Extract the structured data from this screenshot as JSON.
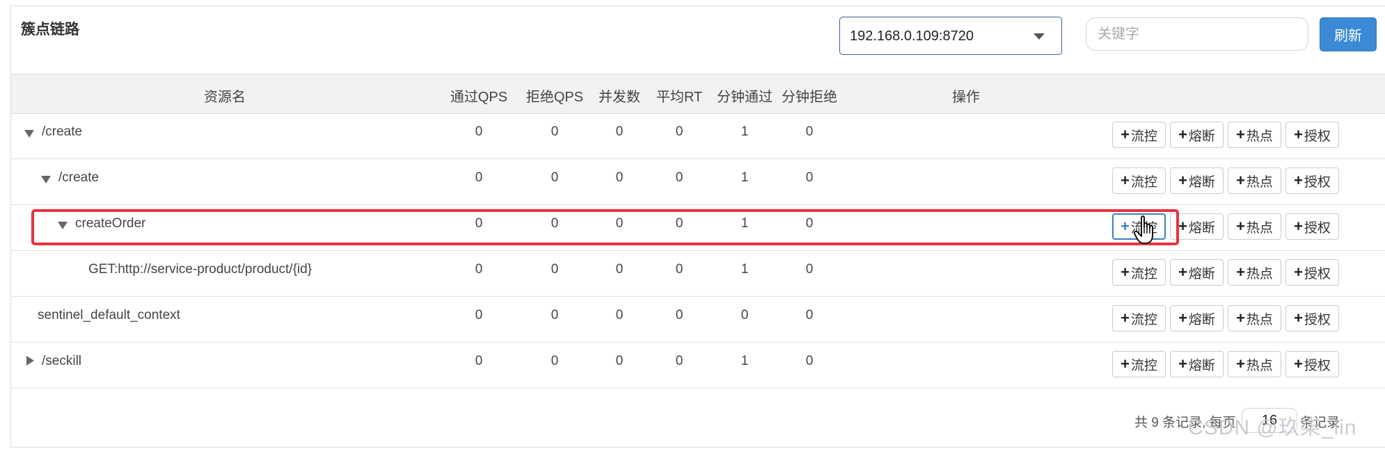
{
  "page": {
    "title": "簇点链路",
    "machine_select": {
      "value": "192.168.0.109:8720"
    },
    "search": {
      "placeholder": "关键字",
      "value": ""
    },
    "refresh_label": "刷新"
  },
  "table": {
    "headers": [
      "资源名",
      "通过QPS",
      "拒绝QPS",
      "并发数",
      "平均RT",
      "分钟通过",
      "分钟拒绝",
      "操作"
    ],
    "rows": [
      {
        "resource": "/create",
        "toggle": "expanded",
        "pass_qps": "0",
        "block_qps": "0",
        "concurrency": "0",
        "avg_rt": "0",
        "minute_pass": "1",
        "minute_block": "0"
      },
      {
        "resource": "/create",
        "toggle": "expanded",
        "pass_qps": "0",
        "block_qps": "0",
        "concurrency": "0",
        "avg_rt": "0",
        "minute_pass": "1",
        "minute_block": "0"
      },
      {
        "resource": "createOrder",
        "toggle": "expanded",
        "pass_qps": "0",
        "block_qps": "0",
        "concurrency": "0",
        "avg_rt": "0",
        "minute_pass": "1",
        "minute_block": "0"
      },
      {
        "resource": "GET:http://service-product/product/{id}",
        "toggle": "none",
        "pass_qps": "0",
        "block_qps": "0",
        "concurrency": "0",
        "avg_rt": "0",
        "minute_pass": "1",
        "minute_block": "0"
      },
      {
        "resource": "sentinel_default_context",
        "toggle": "none",
        "pass_qps": "0",
        "block_qps": "0",
        "concurrency": "0",
        "avg_rt": "0",
        "minute_pass": "0",
        "minute_block": "0"
      },
      {
        "resource": "/seckill",
        "toggle": "collapsed",
        "pass_qps": "0",
        "block_qps": "0",
        "concurrency": "0",
        "avg_rt": "0",
        "minute_pass": "1",
        "minute_block": "0"
      }
    ],
    "actions": [
      "流控",
      "熔断",
      "热点",
      "授权"
    ],
    "highlighted_row": "createOrder"
  },
  "footer": {
    "prefix": "共 9 条记录, 每页",
    "page_size": "16",
    "suffix": "条记录"
  },
  "watermark": "CSDN @玖柒_lin",
  "colors": {
    "primary": "#3c8ad6",
    "highlight": "#e8333f",
    "header_bg": "#f1f2f4"
  },
  "icons": [
    "caret-down-icon",
    "triangle-down-icon",
    "triangle-right-icon",
    "plus-icon",
    "hand-cursor-icon"
  ]
}
